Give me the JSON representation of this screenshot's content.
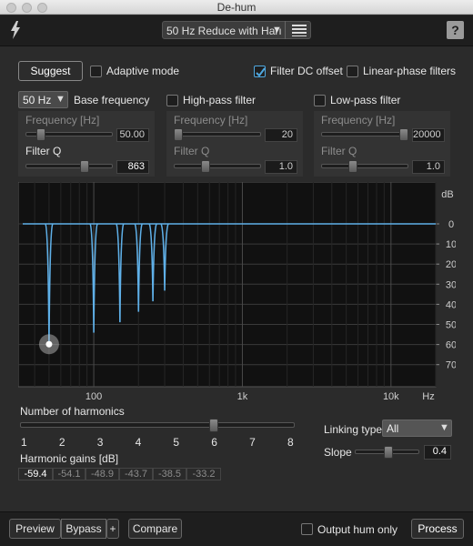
{
  "window": {
    "title": "De-hum"
  },
  "toolbar": {
    "logo_icon": "lightning-icon",
    "preset": "50 Hz Reduce with Harı",
    "preset_arrow": "▼",
    "help": "?"
  },
  "controls": {
    "suggest": "Suggest",
    "adaptive_mode": "Adaptive mode",
    "adaptive_checked": false,
    "filter_dc": "Filter DC offset",
    "filter_dc_checked": true,
    "linear_phase": "Linear-phase filters",
    "linear_phase_checked": false
  },
  "base_section": {
    "select_value": "50 Hz",
    "label": "Base frequency",
    "freq_label": "Frequency [Hz]",
    "freq_value": "50.00",
    "freq_level": 0.05,
    "q_label": "Filter Q",
    "q_value": "863",
    "q_level": 0.7
  },
  "highpass": {
    "label": "High-pass filter",
    "checked": false,
    "freq_label": "Frequency [Hz]",
    "freq_value": "20",
    "freq_level": 0.0,
    "q_label": "Filter Q",
    "q_value": "1.0",
    "q_level": 0.35
  },
  "lowpass": {
    "label": "Low-pass filter",
    "checked": false,
    "freq_label": "Frequency [Hz]",
    "freq_value": "20000",
    "freq_level": 1.0,
    "q_label": "Filter Q",
    "q_value": "1.0",
    "q_level": 0.35
  },
  "graph": {
    "db_label": "dB",
    "db_ticks": [
      "0",
      "10",
      "20",
      "30",
      "40",
      "50",
      "60",
      "70"
    ],
    "hz_label": "Hz",
    "freq_ticks": [
      "100",
      "1k",
      "10k"
    ],
    "notches": [
      {
        "freq": 50,
        "depth": 59.4
      },
      {
        "freq": 100,
        "depth": 54.1
      },
      {
        "freq": 150,
        "depth": 48.9
      },
      {
        "freq": 200,
        "depth": 43.7
      },
      {
        "freq": 250,
        "depth": 38.5
      },
      {
        "freq": 300,
        "depth": 33.2
      }
    ],
    "line_color": "#5fb0e8"
  },
  "harmonics": {
    "label": "Number of harmonics",
    "ticks": [
      "1",
      "2",
      "3",
      "4",
      "5",
      "6",
      "7",
      "8"
    ],
    "value": 6,
    "gains_label": "Harmonic gains [dB]",
    "gains": [
      "-59.4",
      "-54.1",
      "-48.9",
      "-43.7",
      "-38.5",
      "-33.2"
    ]
  },
  "linking": {
    "label": "Linking type",
    "value": "All",
    "arrow": "▼"
  },
  "slope": {
    "label": "Slope",
    "value": "0.4",
    "level": 0.4
  },
  "bottom": {
    "preview": "Preview",
    "bypass": "Bypass",
    "plus": "+",
    "compare": "Compare",
    "output_hum": "Output hum only",
    "output_hum_checked": false,
    "process": "Process"
  }
}
